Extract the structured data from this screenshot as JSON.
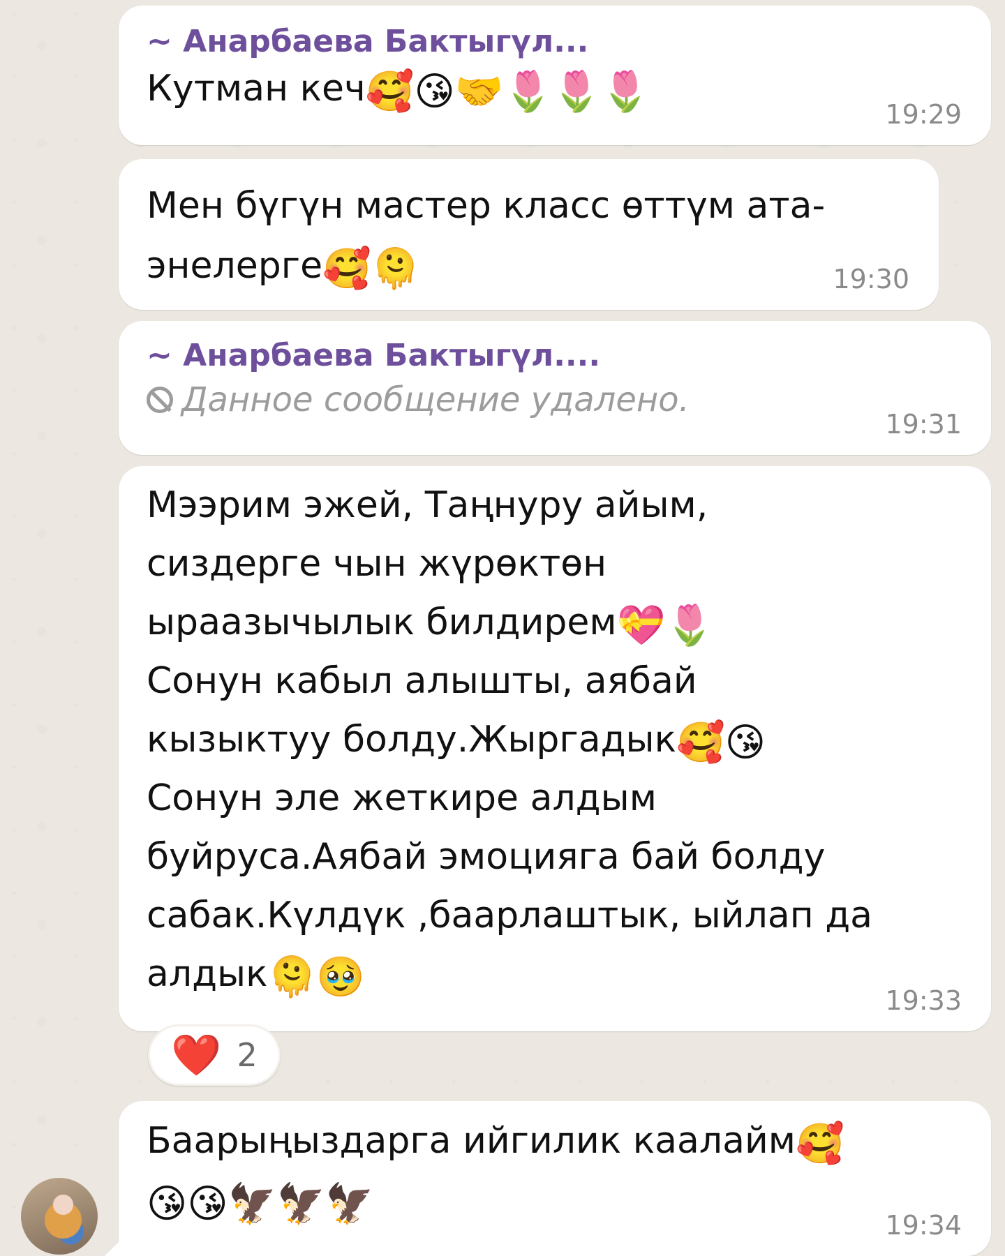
{
  "messages": [
    {
      "sender": "~ Анарбаева Бактыгүл...",
      "text": "Кутман кеч",
      "emojis": "🥰😘🤝🌷🌷🌷",
      "time": "19:29"
    },
    {
      "text": "Мен бүгүн мастер класс өттүм ата-\nэнелерге",
      "emojis": "🥰🫠",
      "time": "19:30"
    },
    {
      "sender": "~ Анарбаева Бактыгүл....",
      "deleted_text": "Данное сообщение удалено.",
      "time": "19:31"
    },
    {
      "text_part1": "Мээрим эжей, Таңнуру айым,\nсиздерге чын жүрөктөн\nыраазычылык билдирем",
      "emojis1": "💝🌷",
      "text_part2": "\nСонун кабыл алышты, аябай\nкызыктуу болду.Жыргадык",
      "emojis2": "🥰😘",
      "text_part3": "\nСонун эле жеткире алдым\nбуйруса.Аябай эмоцияга бай болду\nсабак.Күлдүк ,баарлаштык, ыйлап да\nалдык",
      "emojis3": "🫠🥹",
      "time": "19:33",
      "reaction": {
        "emoji": "❤️",
        "count": "2"
      }
    },
    {
      "text": "Баарыңыздарга ийгилик каалайм",
      "emojis1": "🥰",
      "emojis2": "😘😘🦅🦅🦅",
      "time": "19:34"
    }
  ],
  "colors": {
    "sender": "#6e4f9c",
    "background": "#ece8e1",
    "bubble": "#ffffff",
    "time": "#8a8a8a",
    "deleted": "#9c9c9c"
  }
}
